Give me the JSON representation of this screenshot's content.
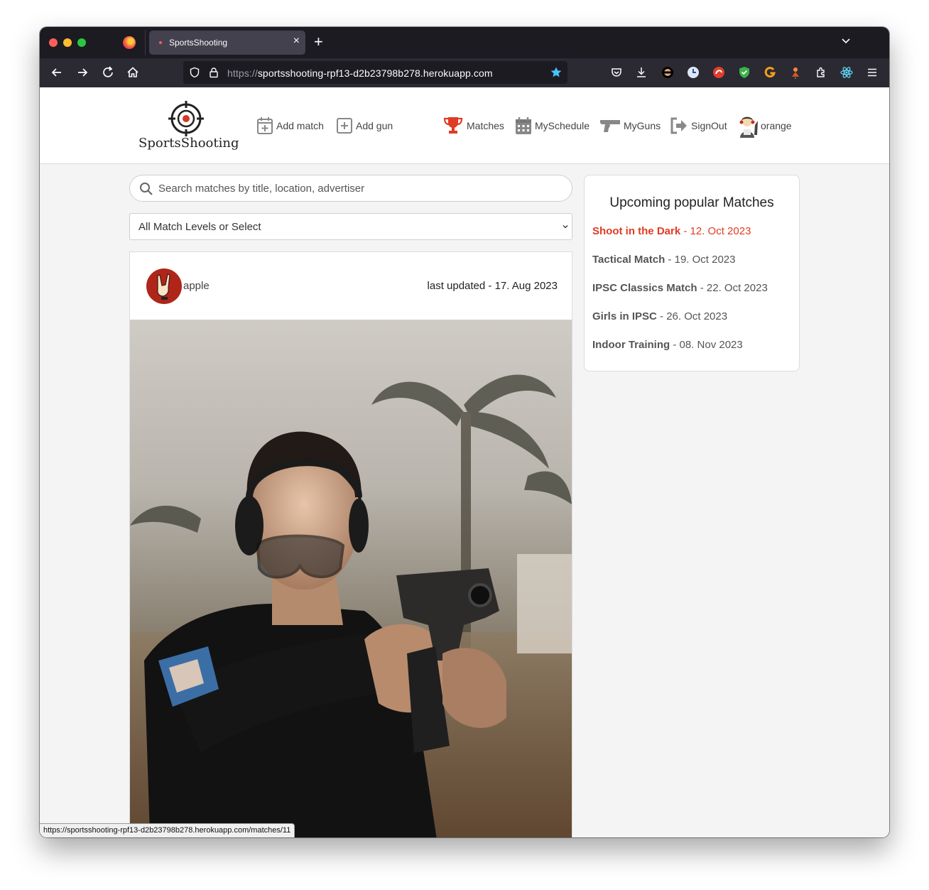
{
  "browser": {
    "tab_title": "SportsShooting",
    "url_scheme": "https://",
    "url_host": "sportsshooting-rpf13-d2b23798b278.herokuapp.com",
    "status_url": "https://sportsshooting-rpf13-d2b23798b278.herokuapp.com/matches/11"
  },
  "header": {
    "logo_text": "SportsShooting",
    "nav": {
      "add_match": "Add match",
      "add_gun": "Add gun",
      "matches": "Matches",
      "myschedule": "MySchedule",
      "myguns": "MyGuns",
      "signout": "SignOut",
      "user": "orange"
    }
  },
  "filters": {
    "search_placeholder": "Search matches by title, location, advertiser",
    "level_select": "All Match Levels or Select"
  },
  "match_card": {
    "author": "apple",
    "updated": "last updated - 17. Aug 2023"
  },
  "sidebar": {
    "title": "Upcoming popular Matches",
    "items": [
      {
        "name": "Shoot in the Dark",
        "date": " - 12. Oct 2023"
      },
      {
        "name": "Tactical Match",
        "date": " - 19. Oct 2023"
      },
      {
        "name": "IPSC Classics Match",
        "date": " - 22. Oct 2023"
      },
      {
        "name": "Girls in IPSC",
        "date": " - 26. Oct 2023"
      },
      {
        "name": "Indoor Training",
        "date": " - 08. Nov 2023"
      }
    ]
  },
  "colors": {
    "accent": "#e03b24",
    "chrome_dark": "#1c1b22",
    "chrome_toolbar": "#2b2a33"
  }
}
